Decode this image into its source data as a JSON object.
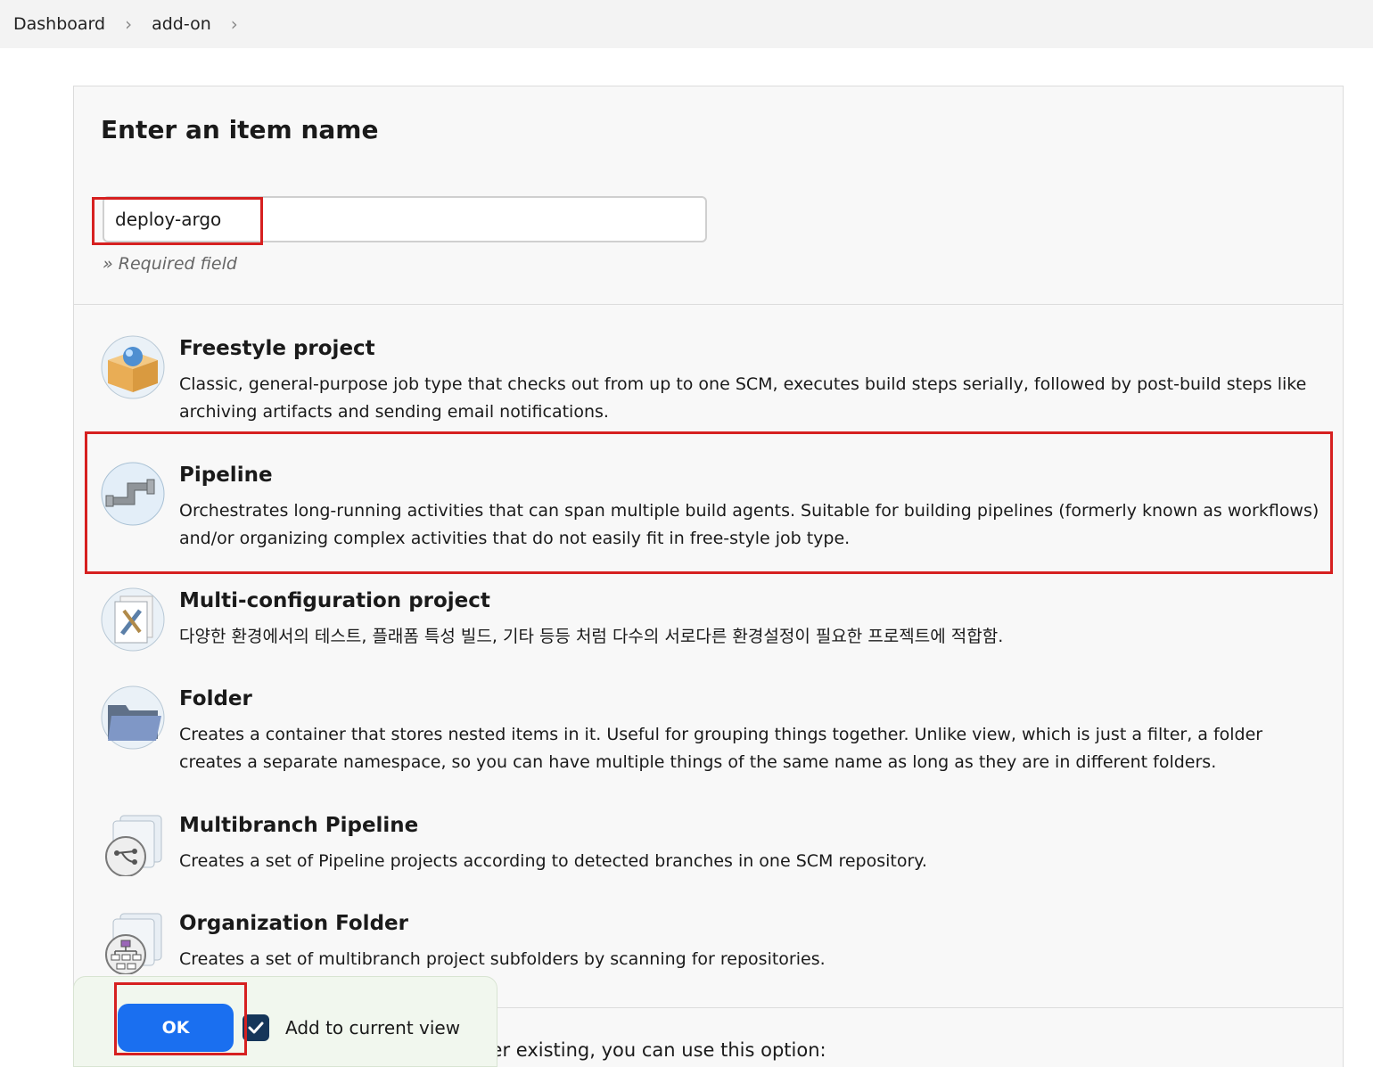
{
  "breadcrumb": {
    "items": [
      "Dashboard",
      "add-on"
    ]
  },
  "form": {
    "title": "Enter an item name",
    "item_name_value": "deploy-argo",
    "required_note": "» Required field"
  },
  "item_types": [
    {
      "name": "Freestyle project",
      "description": "Classic, general-purpose job type that checks out from up to one SCM, executes build steps serially, followed by post-build steps like archiving artifacts and sending email notifications.",
      "icon": "freestyle-box-icon"
    },
    {
      "name": "Pipeline",
      "description": "Orchestrates long-running activities that can span multiple build agents. Suitable for building pipelines (formerly known as workflows) and/or organizing complex activities that do not easily fit in free-style job type.",
      "icon": "pipeline-pipe-icon"
    },
    {
      "name": "Multi-configuration project",
      "description": "다양한 환경에서의 테스트, 플래폼 특성 빌드, 기타 등등 처럼 다수의 서로다른 환경설정이 필요한 프로젝트에 적합함.",
      "icon": "multi-config-tools-icon"
    },
    {
      "name": "Folder",
      "description": "Creates a container that stores nested items in it. Useful for grouping things together. Unlike view, which is just a filter, a folder creates a separate namespace, so you can have multiple things of the same name as long as they are in different folders.",
      "icon": "folder-icon"
    },
    {
      "name": "Multibranch Pipeline",
      "description": "Creates a set of Pipeline projects according to detected branches in one SCM repository.",
      "icon": "multibranch-icon"
    },
    {
      "name": "Organization Folder",
      "description": "Creates a set of multibranch project subfolders by scanning for repositories.",
      "icon": "organization-folder-icon"
    }
  ],
  "footer": {
    "ok_label": "OK",
    "add_to_view_label": "Add to current view",
    "add_to_view_checked": true,
    "copy_hint": "If you want to create a new item from other existing, you can use this option:"
  },
  "colors": {
    "highlight": "#d62020",
    "ok_button": "#1a6ff0",
    "checkbox": "#16365a"
  }
}
